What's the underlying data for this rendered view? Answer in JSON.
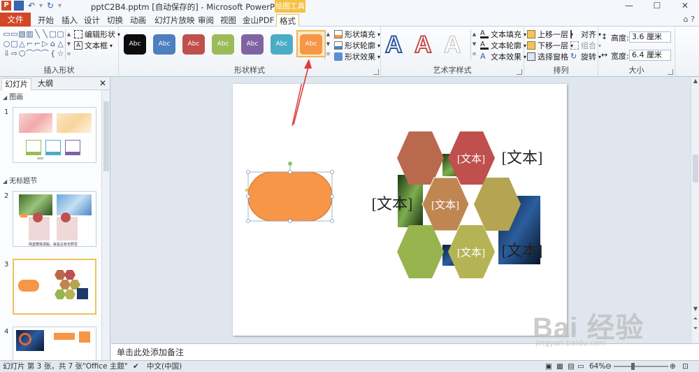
{
  "titlebar": {
    "title": "pptC2B4.pptm [自动保存的] - Microsoft PowerPoint",
    "drawing_tools": "绘图工具",
    "min": "—",
    "max": "☐",
    "close": "✕"
  },
  "tabs": {
    "file": "文件",
    "items": [
      "开始",
      "插入",
      "设计",
      "切换",
      "动画",
      "幻灯片放映",
      "审阅",
      "视图",
      "金山PDF",
      "格式"
    ],
    "help": "⌂ ?"
  },
  "ribbon": {
    "insert_shapes": {
      "label": "插入形状",
      "edit_shape": "编辑形状",
      "text_box": "文本框",
      "shape_glyphs": [
        "▭",
        "▭",
        "▧",
        "▥",
        "╲",
        "╲",
        "□",
        "▢",
        "○",
        "□",
        "△",
        "⌐",
        "⌐",
        "▷",
        "⌂",
        "△",
        "⇩",
        "⇨",
        "⬡",
        "⌒",
        "⌒",
        "⌒",
        "{",
        "☆"
      ]
    },
    "shape_styles": {
      "label": "形状样式",
      "thumb_text": "Abc",
      "styles": [
        {
          "color": "#0d0d0d"
        },
        {
          "color": "#4e7fbf"
        },
        {
          "color": "#c0504d"
        },
        {
          "color": "#9bbb59"
        },
        {
          "color": "#8064a2"
        },
        {
          "color": "#4bacc6"
        },
        {
          "color": "#f79646"
        }
      ],
      "fill": "形状填充",
      "outline": "形状轮廓",
      "effects": "形状效果"
    },
    "wordart": {
      "label": "艺术字样式",
      "letter": "A",
      "text_fill": "文本填充",
      "text_outline": "文本轮廓",
      "text_effects": "文本效果"
    },
    "arrange": {
      "label": "排列",
      "bring_forward": "上移一层",
      "send_backward": "下移一层",
      "selection_pane": "选择窗格",
      "align": "对齐",
      "group": "组合",
      "rotate": "旋转"
    },
    "size": {
      "label": "大小",
      "height_label": "高度:",
      "height_value": "3.6 厘米",
      "width_label": "宽度:",
      "width_value": "6.4 厘米"
    }
  },
  "panel": {
    "tab_slides": "幻灯片",
    "tab_outline": "大纲",
    "close": "✕",
    "section1": "图画",
    "section2": "无标题节",
    "slides": [
      "1",
      "2",
      "3",
      "4"
    ],
    "slide2_caption": "简直要搭调般，就是古有无照至",
    "slide1_caption": "ooo"
  },
  "slide": {
    "hex_text": "[文本]",
    "outer_text": "[文本]",
    "shape_color": "#f79646"
  },
  "notes": {
    "placeholder": "单击此处添加备注"
  },
  "status": {
    "slide_info": "幻灯片 第 3 张，共 7 张",
    "theme": "\"Office 主题\"",
    "language": "中文(中国)",
    "zoom": "64%",
    "minus": "⊖",
    "plus": "⊕"
  },
  "watermark": {
    "big": "Bai  经验",
    "small": "jingyan.baidu.com"
  }
}
